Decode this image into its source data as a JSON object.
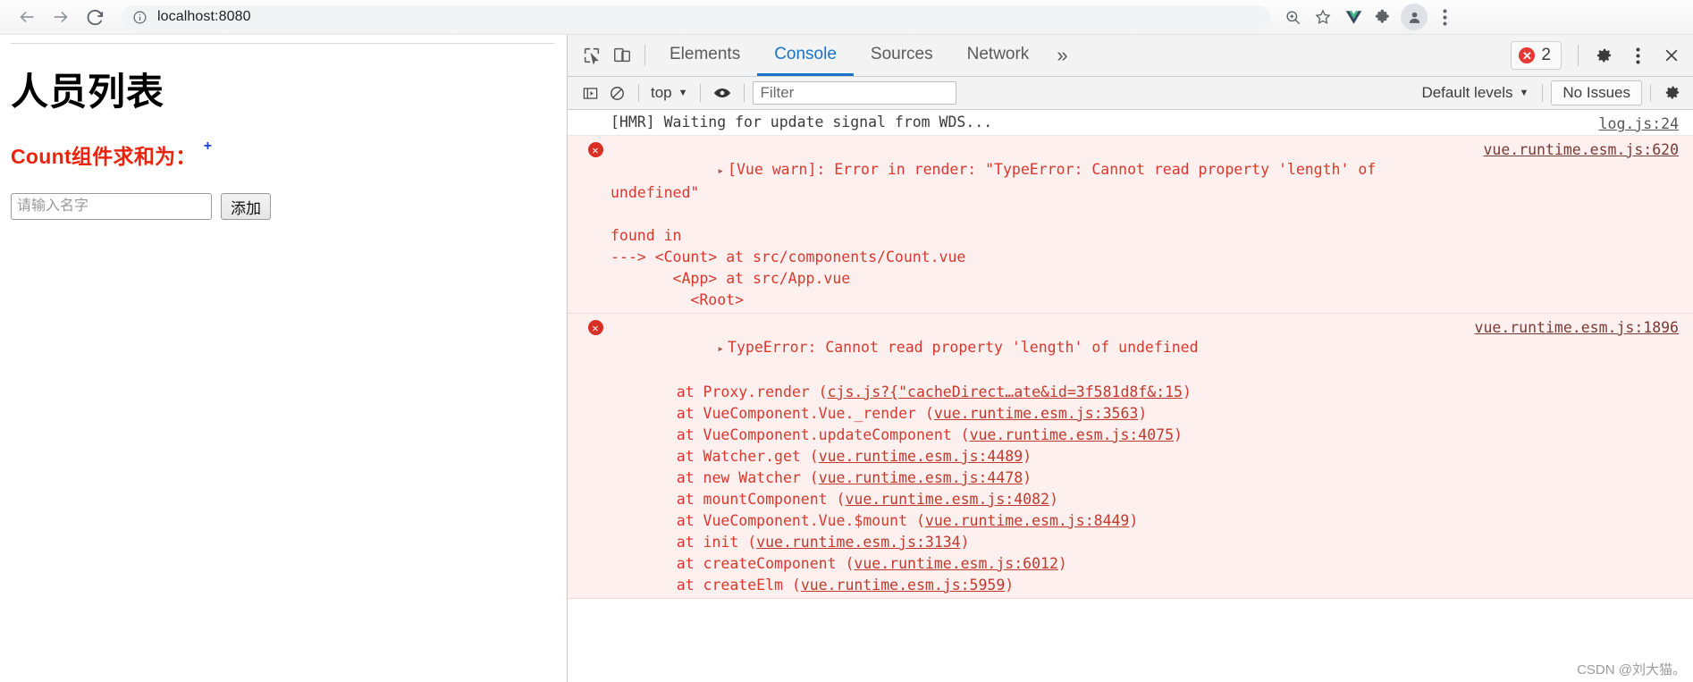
{
  "browser": {
    "back_icon": "back-arrow-icon",
    "forward_icon": "forward-arrow-icon",
    "reload_icon": "reload-icon",
    "site_info_icon": "info-circle-icon",
    "url": "localhost:8080",
    "toolbar_icons": [
      "zoom-icon",
      "bookmark-star-icon",
      "vue-devtools-icon",
      "extensions-puzzle-icon",
      "profile-avatar-icon",
      "chrome-menu-icon"
    ]
  },
  "page": {
    "title": "人员列表",
    "count_label": "Count组件求和为：",
    "count_sup": "+",
    "input_placeholder": "请输入名字",
    "input_value": "",
    "add_button": "添加"
  },
  "devtools": {
    "inspect_icon": "inspect-element-icon",
    "device_icon": "device-toolbar-icon",
    "tabs": [
      {
        "label": "Elements",
        "active": false
      },
      {
        "label": "Console",
        "active": true
      },
      {
        "label": "Sources",
        "active": false
      },
      {
        "label": "Network",
        "active": false
      }
    ],
    "more_tabs_icon": "chevron-double-right-icon",
    "error_badge": {
      "icon": "error-circle-icon",
      "count": "2"
    },
    "settings_icon": "gear-icon",
    "menu_icon": "kebab-menu-icon",
    "close_icon": "close-icon",
    "filterbar": {
      "sidebar_icon": "console-sidebar-icon",
      "clear_icon": "clear-console-icon",
      "context": "top",
      "context_caret": "▼",
      "eye_icon": "live-expression-eye-icon",
      "filter_placeholder": "Filter",
      "filter_value": "",
      "levels": "Default levels",
      "levels_caret": "▼",
      "issues": "No Issues",
      "settings_icon": "gear-icon"
    },
    "messages": [
      {
        "level": "info",
        "text": "[HMR] Waiting for update signal from WDS...",
        "source": "log.js:24"
      },
      {
        "level": "error",
        "expand_arrow": "▸",
        "text": "[Vue warn]: Error in render: \"TypeError: Cannot read property 'length' of undefined\"",
        "source": "vue.runtime.esm.js:620",
        "extra_lines": [
          "",
          "found in",
          "",
          "---> <Count> at src/components/Count.vue",
          "       <App> at src/App.vue",
          "         <Root>"
        ]
      },
      {
        "level": "error",
        "expand_arrow": "▸",
        "text": "TypeError: Cannot read property 'length' of undefined",
        "source": "vue.runtime.esm.js:1896",
        "stack": [
          {
            "fn": "    at Proxy.render (",
            "link": "cjs.js?{\"cacheDirect…ate&id=3f581d8f&:15",
            "tail": ")"
          },
          {
            "fn": "    at VueComponent.Vue._render (",
            "link": "vue.runtime.esm.js:3563",
            "tail": ")"
          },
          {
            "fn": "    at VueComponent.updateComponent (",
            "link": "vue.runtime.esm.js:4075",
            "tail": ")"
          },
          {
            "fn": "    at Watcher.get (",
            "link": "vue.runtime.esm.js:4489",
            "tail": ")"
          },
          {
            "fn": "    at new Watcher (",
            "link": "vue.runtime.esm.js:4478",
            "tail": ")"
          },
          {
            "fn": "    at mountComponent (",
            "link": "vue.runtime.esm.js:4082",
            "tail": ")"
          },
          {
            "fn": "    at VueComponent.Vue.$mount (",
            "link": "vue.runtime.esm.js:8449",
            "tail": ")"
          },
          {
            "fn": "    at init (",
            "link": "vue.runtime.esm.js:3134",
            "tail": ")"
          },
          {
            "fn": "    at createComponent (",
            "link": "vue.runtime.esm.js:6012",
            "tail": ")"
          },
          {
            "fn": "    at createElm (",
            "link": "vue.runtime.esm.js:5959",
            "tail": ")"
          }
        ]
      }
    ]
  },
  "watermark": "CSDN @刘大猫。",
  "colors": {
    "accent": "#1a73c8",
    "error": "#d8392e",
    "error_bg": "#fff0f0",
    "count_red": "#e8240c",
    "sup_blue": "#1a3de0"
  }
}
